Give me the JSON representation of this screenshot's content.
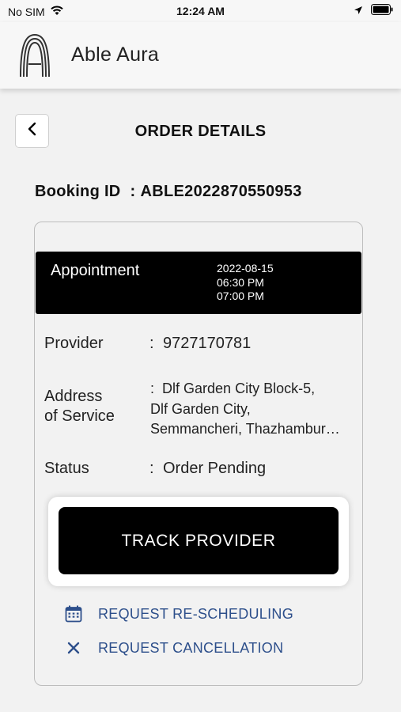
{
  "status_bar": {
    "carrier": "No SIM",
    "time": "12:24 AM",
    "icons": [
      "wifi-icon",
      "location-arrow-icon",
      "battery-icon"
    ]
  },
  "app": {
    "title": "Able Aura",
    "logo": "able-aura-logo"
  },
  "page": {
    "title": "ORDER DETAILS",
    "back_icon": "chevron-left-icon"
  },
  "booking": {
    "label": "Booking ID",
    "separator": ":",
    "id": "ABLE2022870550953"
  },
  "appointment": {
    "label": "Appointment",
    "date": "2022-08-15",
    "start_time": "06:30 PM",
    "end_time": "07:00 PM"
  },
  "details": {
    "colon": ":",
    "provider_label": "Provider",
    "provider_value": "9727170781",
    "address_label_line1": "Address",
    "address_label_line2": "of Service",
    "address_lines": [
      "Dlf Garden City Block-5,",
      "Dlf Garden City,",
      "Semmancheri, Thazhambur…"
    ],
    "status_label": "Status",
    "status_value": "Order Pending"
  },
  "actions": {
    "track_label": "TRACK PROVIDER",
    "reschedule_label": "REQUEST RE-SCHEDULING",
    "reschedule_icon": "calendar-icon",
    "cancel_label": "REQUEST CANCELLATION",
    "cancel_icon": "close-icon"
  },
  "colors": {
    "background": "#f2f2f2",
    "primary_dark": "#000000",
    "link_blue": "#2d4f8b"
  }
}
